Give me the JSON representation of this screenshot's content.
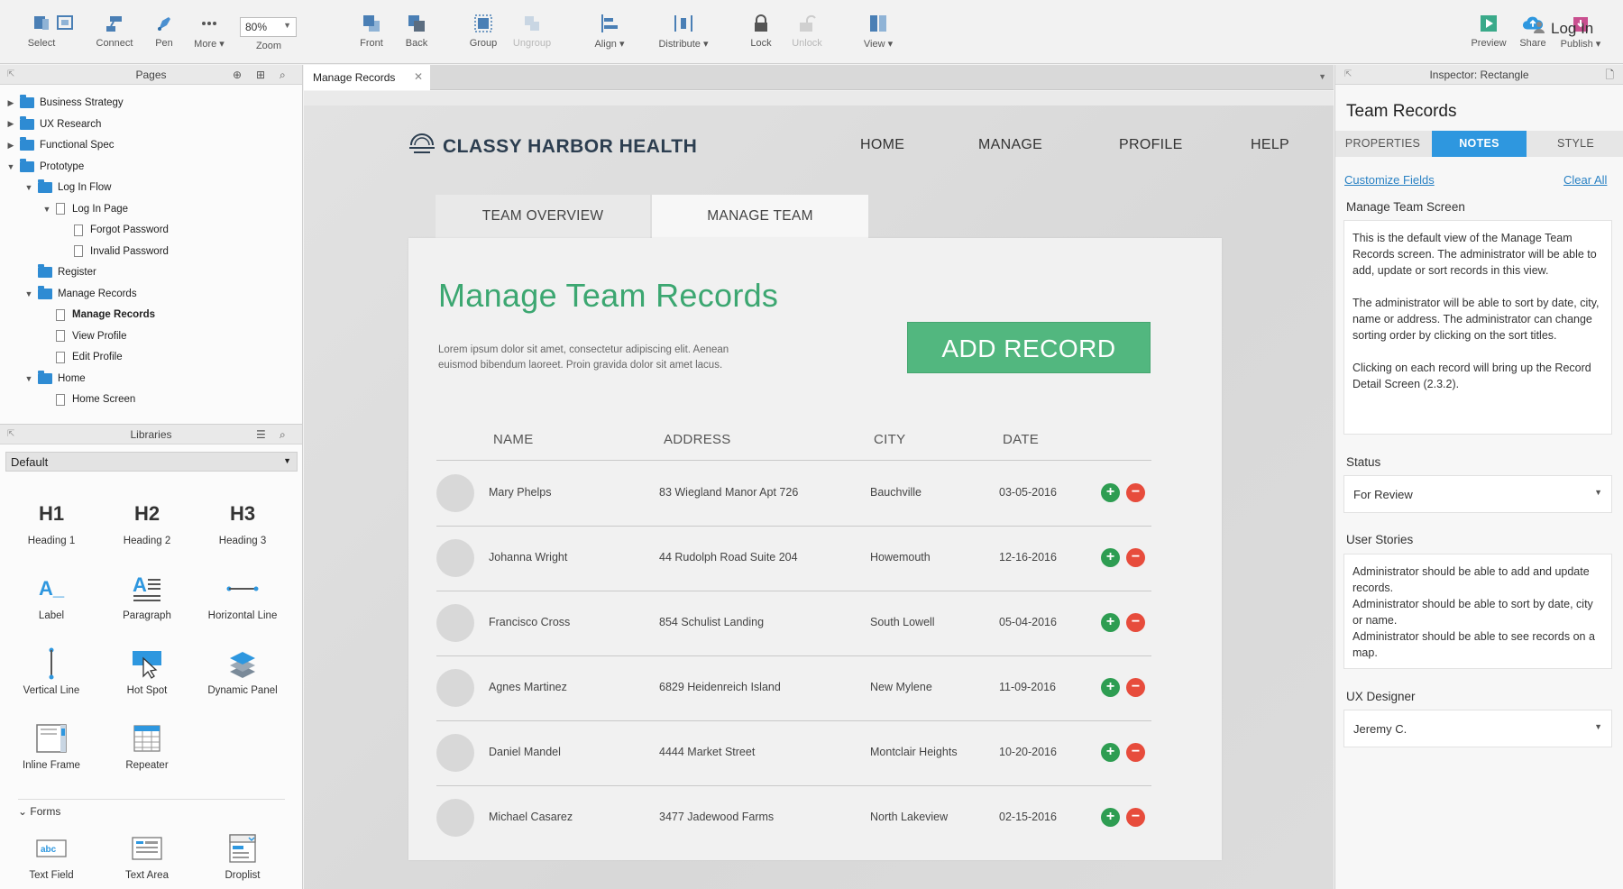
{
  "toolbar": {
    "select": "Select",
    "connect": "Connect",
    "pen": "Pen",
    "more": "More ▾",
    "zoom_value": "80%",
    "zoom_label": "Zoom",
    "front": "Front",
    "back": "Back",
    "group": "Group",
    "ungroup": "Ungroup",
    "align": "Align ▾",
    "distribute": "Distribute ▾",
    "lock": "Lock",
    "unlock": "Unlock",
    "view": "View ▾",
    "preview": "Preview",
    "share": "Share",
    "publish": "Publish ▾",
    "login": "Log In"
  },
  "pages_panel": {
    "title": "Pages",
    "items": [
      {
        "label": "Business Strategy",
        "type": "folder",
        "expanded": false
      },
      {
        "label": "UX Research",
        "type": "folder",
        "expanded": false
      },
      {
        "label": "Functional Spec",
        "type": "folder",
        "expanded": false
      },
      {
        "label": "Prototype",
        "type": "folder",
        "expanded": true
      },
      {
        "label": "Log In Flow",
        "type": "folder",
        "expanded": true
      },
      {
        "label": "Log In Page",
        "type": "page",
        "expanded": true
      },
      {
        "label": "Forgot Password",
        "type": "page"
      },
      {
        "label": "Invalid Password",
        "type": "page"
      },
      {
        "label": "Register",
        "type": "folder"
      },
      {
        "label": "Manage Records",
        "type": "folder",
        "expanded": true
      },
      {
        "label": "Manage Records",
        "type": "page",
        "selected": true
      },
      {
        "label": "View Profile",
        "type": "page"
      },
      {
        "label": "Edit Profile",
        "type": "page"
      },
      {
        "label": "Home",
        "type": "folder",
        "expanded": true
      },
      {
        "label": "Home Screen",
        "type": "page"
      }
    ]
  },
  "libraries_panel": {
    "title": "Libraries",
    "selected_library": "Default",
    "widgets": [
      {
        "label": "Heading 1",
        "glyph": "H1"
      },
      {
        "label": "Heading 2",
        "glyph": "H2"
      },
      {
        "label": "Heading 3",
        "glyph": "H3"
      },
      {
        "label": "Label",
        "glyph": "A_"
      },
      {
        "label": "Paragraph",
        "glyph": "A"
      },
      {
        "label": "Horizontal Line"
      },
      {
        "label": "Vertical Line"
      },
      {
        "label": "Hot Spot"
      },
      {
        "label": "Dynamic Panel"
      },
      {
        "label": "Inline Frame"
      },
      {
        "label": "Repeater"
      }
    ],
    "forms_section": "Forms",
    "form_widgets": [
      {
        "label": "Text Field",
        "glyph": "abc"
      },
      {
        "label": "Text Area"
      },
      {
        "label": "Droplist"
      }
    ]
  },
  "canvas": {
    "tab_label": "Manage Records",
    "wireframe": {
      "logo_text": "CLASSY HARBOR HEALTH",
      "nav": [
        "HOME",
        "MANAGE",
        "PROFILE",
        "HELP"
      ],
      "tabs": [
        "TEAM OVERVIEW",
        "MANAGE TEAM"
      ],
      "title": "Manage Team Records",
      "description": "Lorem ipsum dolor sit amet, consectetur adipiscing elit. Aenean euismod bibendum laoreet. Proin gravida dolor sit amet lacus.",
      "add_button": "ADD RECORD",
      "columns": [
        "NAME",
        "ADDRESS",
        "CITY",
        "DATE"
      ],
      "rows": [
        {
          "name": "Mary Phelps",
          "address": "83 Wiegland Manor Apt 726",
          "city": "Bauchville",
          "date": "03-05-2016"
        },
        {
          "name": "Johanna Wright",
          "address": "44 Rudolph Road Suite 204",
          "city": "Howemouth",
          "date": "12-16-2016"
        },
        {
          "name": "Francisco Cross",
          "address": "854 Schulist Landing",
          "city": "South Lowell",
          "date": "05-04-2016"
        },
        {
          "name": "Agnes Martinez",
          "address": "6829 Heidenreich Island",
          "city": "New Mylene",
          "date": "11-09-2016"
        },
        {
          "name": "Daniel Mandel",
          "address": "4444 Market Street",
          "city": "Montclair Heights",
          "date": "10-20-2016"
        },
        {
          "name": "Michael Casarez",
          "address": "3477 Jadewood Farms",
          "city": "North Lakeview",
          "date": "02-15-2016"
        }
      ]
    }
  },
  "inspector": {
    "header": "Inspector: Rectangle",
    "title": "Team Records",
    "tabs": [
      "PROPERTIES",
      "NOTES",
      "STYLE"
    ],
    "active_tab": "NOTES",
    "customize_fields": "Customize Fields",
    "clear_all": "Clear All",
    "field_label": "Manage Team Screen",
    "notes": [
      "This is the default view of the Manage Team Records screen. The administrator will be able to add, update or sort records in this view.",
      "The administrator will be able to sort by date, city, name or address. The administrator can change sorting order by clicking on the sort titles.",
      "Clicking on each record will bring up the Record Detail Screen (2.3.2)."
    ],
    "status_label": "Status",
    "status_value": "For Review",
    "user_stories_label": "User Stories",
    "user_stories": "Administrator should be able to add and update records.\nAdministrator should be able to sort by date, city or name.\nAdministrator should be able to see records on a map.",
    "ux_designer_label": "UX Designer",
    "ux_designer_value": "Jeremy C."
  },
  "colors": {
    "accent_blue": "#2e97df",
    "folder_blue": "#2e8bd3",
    "brand_green": "#52b77f",
    "title_green": "#3ca771",
    "add_green": "#2e9d52",
    "remove_red": "#e74c3c"
  }
}
